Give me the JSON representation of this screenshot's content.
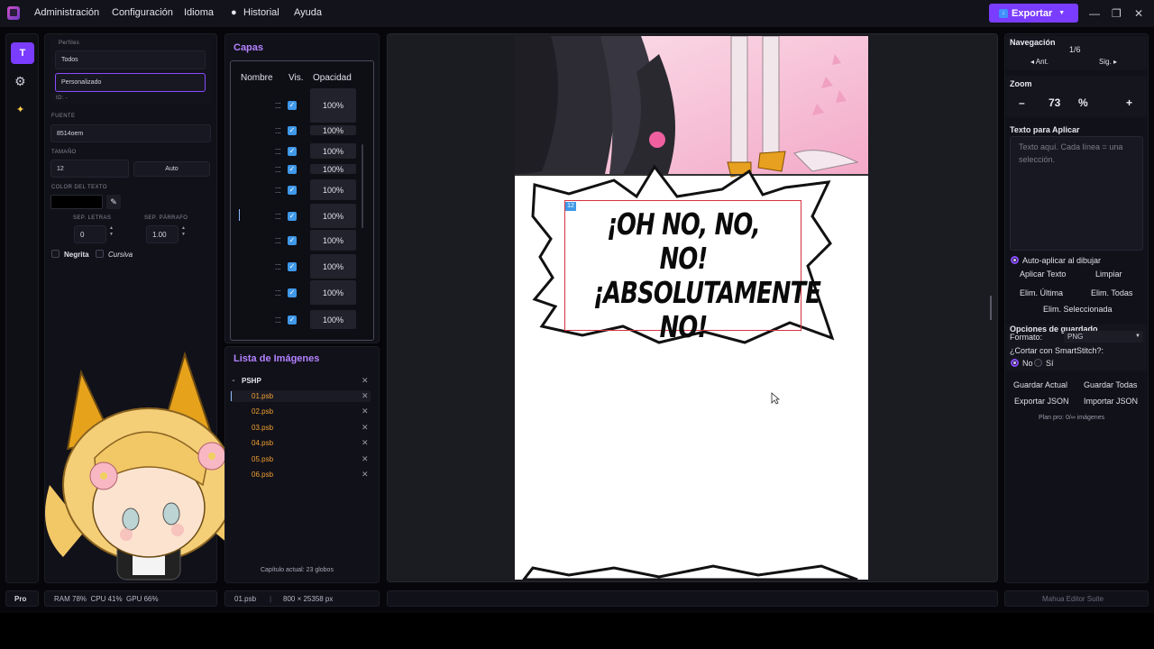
{
  "menu": {
    "items": [
      "Administración",
      "Configuración",
      "Idioma",
      "Historial",
      "Ayuda"
    ],
    "export_label": "Exportar"
  },
  "tools": {
    "text_tool_label": "T"
  },
  "properties": {
    "profiles_label": "Perfiles",
    "profiles": [
      "Todos",
      "Personalizado"
    ],
    "id_label": "ID: -",
    "font_label": "FUENTE",
    "font_value": "8514oem",
    "size_label": "TAMAÑO",
    "size_value": "12",
    "size_auto_label": "Auto",
    "color_label": "COLOR DEL TEXTO",
    "color_value": "#000000",
    "letter_spacing_label": "SEP. LETRAS",
    "letter_spacing_value": "0",
    "paragraph_spacing_label": "SEP. PÁRRAFO",
    "paragraph_spacing_value": "1.00",
    "bold_label": "Negrita",
    "italic_label": "Cursiva"
  },
  "layers": {
    "title": "Capas",
    "col_name": "Nombre",
    "col_vis": "Vis.",
    "col_opacity": "Opacidad",
    "rows": [
      {
        "opacity": "100%"
      },
      {
        "opacity": "100%"
      },
      {
        "opacity": "100%"
      },
      {
        "opacity": "100%"
      },
      {
        "opacity": "100%"
      },
      {
        "opacity": "100%"
      },
      {
        "opacity": "100%"
      },
      {
        "opacity": "100%"
      },
      {
        "opacity": "100%"
      },
      {
        "opacity": "100%"
      }
    ]
  },
  "image_list": {
    "title": "Lista de Imágenes",
    "folder": "PSHP",
    "files": [
      "01.psb",
      "02.psb",
      "03.psb",
      "04.psb",
      "05.psb",
      "06.psb"
    ],
    "chapter_status": "Capítulo actual: 23 globos"
  },
  "canvas": {
    "bubble_number": "12",
    "bubble_lines": [
      "¡OH NO, NO, NO!",
      "¡ABSOLUTAMENTE",
      "NO!"
    ]
  },
  "right_panel": {
    "nav_title": "Navegación",
    "page_indicator": "1/6",
    "prev_label": "◂ Ant.",
    "next_label": "Sig. ▸",
    "zoom_title": "Zoom",
    "zoom_minus": "–",
    "zoom_value": "73",
    "zoom_unit": "%",
    "zoom_plus": "+",
    "apply_title": "Texto para Aplicar",
    "apply_placeholder": "Texto aquí. Cada línea = una selección.",
    "auto_apply_label": "Auto-aplicar al dibujar",
    "apply_text_btn": "Aplicar Texto",
    "clear_btn": "Limpiar",
    "del_last_btn": "Elim. Última",
    "del_all_btn": "Elim. Todas",
    "del_selected_btn": "Elim. Seleccionada",
    "save_options_title": "Opciones de guardado",
    "format_label": "Formato:",
    "format_value": "PNG",
    "smartstitch_label": "¿Cortar con SmartStitch?:",
    "opt_no": "No",
    "opt_yes": "Sí",
    "save_current_btn": "Guardar Actual",
    "save_all_btn": "Guardar Todas",
    "export_json_btn": "Exportar JSON",
    "import_json_btn": "Importar JSON",
    "plan_text": "Plan pro: 0/∞ imágenes"
  },
  "status": {
    "tier": "Pro",
    "resources": "RAM 78%  CPU 41%  GPU 66%",
    "file": "01.psb",
    "dimensions": "800 × 25358 px",
    "suite": "Mahua Editor Suite"
  },
  "colors": {
    "accent": "#7a3cff",
    "checkbox": "#3f98e8",
    "file_orange": "#f0a030",
    "panel_title": "#b382ff"
  }
}
